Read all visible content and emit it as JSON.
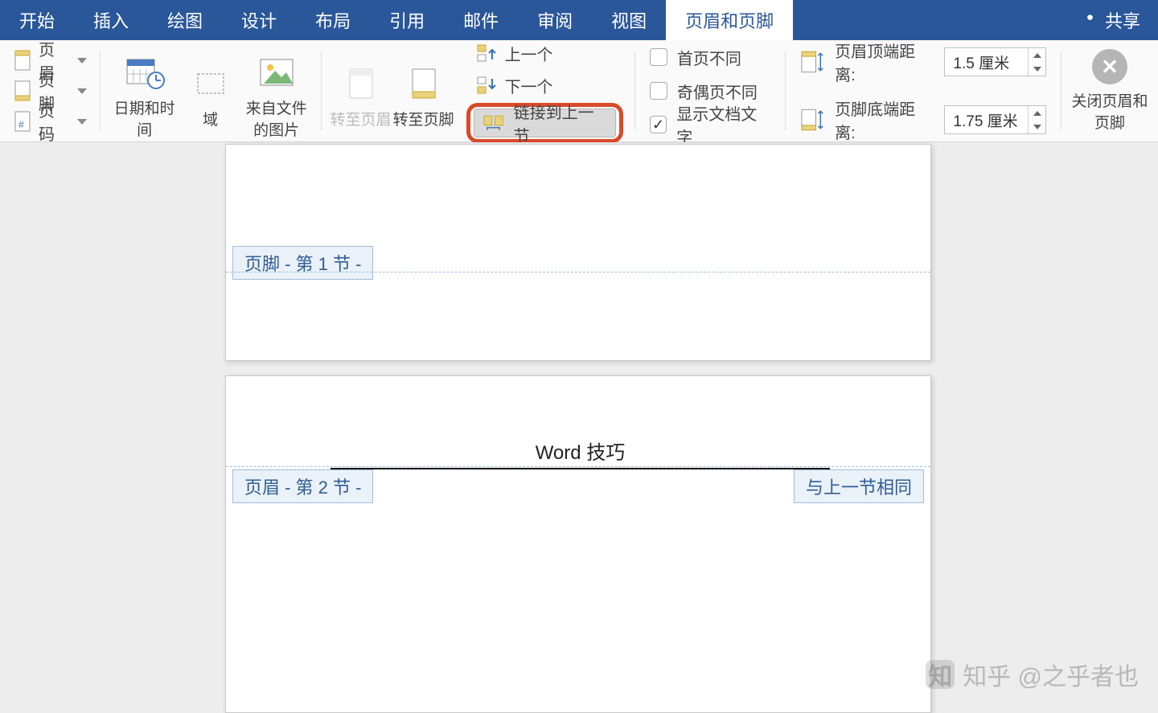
{
  "tabs": {
    "items": [
      {
        "label": "开始"
      },
      {
        "label": "插入"
      },
      {
        "label": "绘图"
      },
      {
        "label": "设计"
      },
      {
        "label": "布局"
      },
      {
        "label": "引用"
      },
      {
        "label": "邮件"
      },
      {
        "label": "审阅"
      },
      {
        "label": "视图"
      },
      {
        "label": "页眉和页脚"
      }
    ],
    "share": "共享"
  },
  "ribbon": {
    "header": "页眉",
    "footer": "页脚",
    "pagenum": "页码",
    "datetime": "日期和时间",
    "field": "域",
    "pic_from_file": "来自文件的图片",
    "goto_header": "转至页眉",
    "goto_footer": "转至页脚",
    "prev": "上一个",
    "next": "下一个",
    "link_prev": "链接到上一节",
    "diff_first": "首页不同",
    "diff_oddeven": "奇偶页不同",
    "show_doctext": "显示文档文字",
    "dist_header_label": "页眉顶端距离:",
    "dist_footer_label": "页脚底端距离:",
    "dist_header_val": "1.5 厘米",
    "dist_footer_val": "1.75 厘米",
    "close": "关闭页眉和页脚"
  },
  "doc": {
    "footer_tag1": "页脚 - 第 1 节 -",
    "header_tag2": "页眉 - 第 2 节 -",
    "same_as_prev": "与上一节相同",
    "header_text": "Word 技巧"
  },
  "watermark": "知乎 @之乎者也"
}
